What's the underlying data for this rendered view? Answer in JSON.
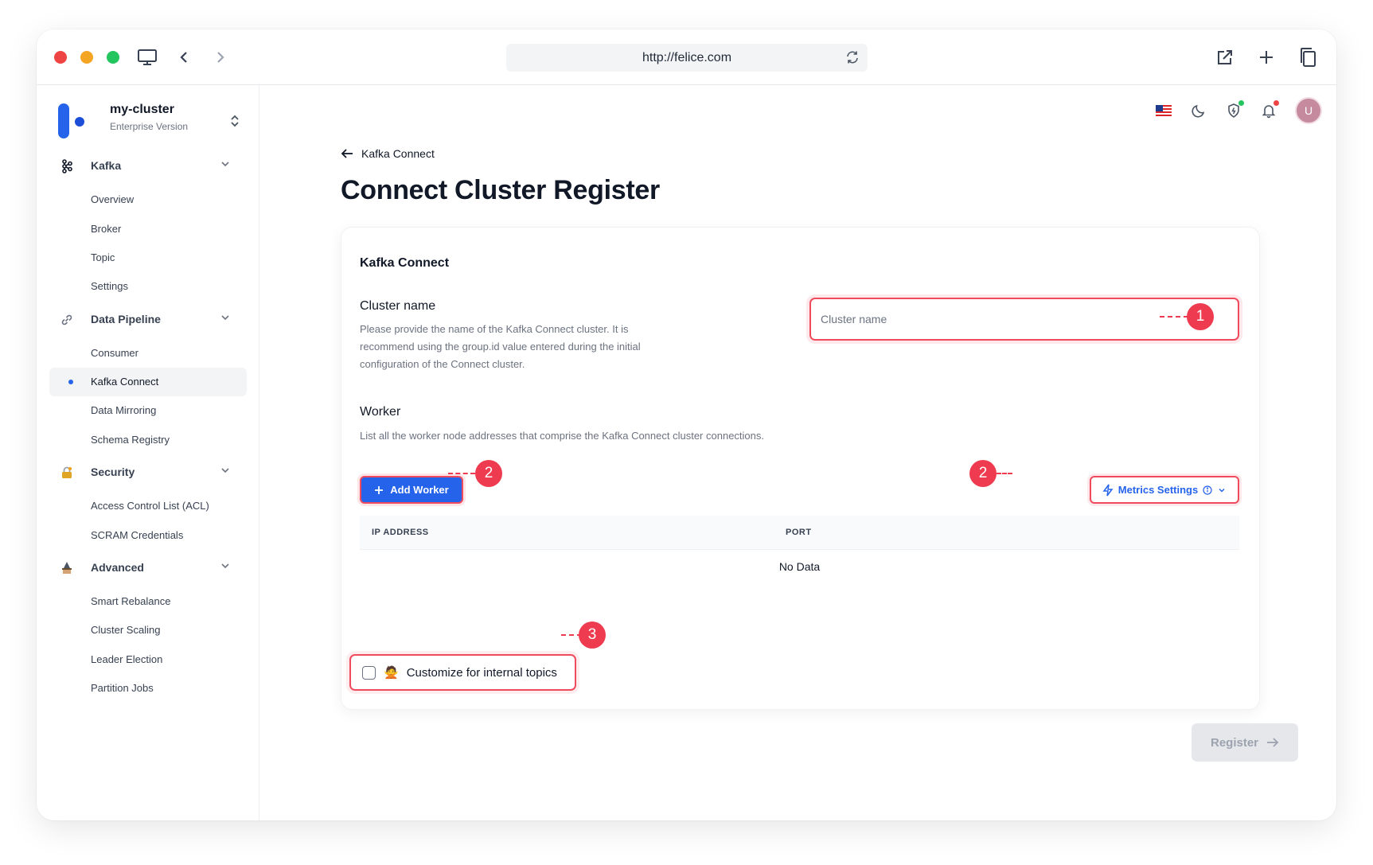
{
  "browser": {
    "url": "http://felice.com",
    "traffic_lights": [
      "#ef4444",
      "#f5a524",
      "#22c55e"
    ]
  },
  "sidebar": {
    "cluster_name": "my-cluster",
    "cluster_edition": "Enterprise Version",
    "groups": [
      {
        "label": "Kafka",
        "icon": "kafka-icon",
        "items": [
          "Overview",
          "Broker",
          "Topic",
          "Settings"
        ]
      },
      {
        "label": "Data Pipeline",
        "icon": "link-icon",
        "items": [
          "Consumer",
          "Kafka Connect",
          "Data Mirroring",
          "Schema Registry"
        ]
      },
      {
        "label": "Security",
        "icon": "lock-icon",
        "items": [
          "Access Control List (ACL)",
          "SCRAM Credentials"
        ]
      },
      {
        "label": "Advanced",
        "icon": "wizard-icon",
        "items": [
          "Smart Rebalance",
          "Cluster Scaling",
          "Leader Election",
          "Partition Jobs"
        ]
      }
    ],
    "active_item": "Kafka Connect"
  },
  "header": {
    "avatar_initial": "U",
    "icons": [
      "us-flag-icon",
      "moon-icon",
      "shield-icon",
      "bell-icon"
    ]
  },
  "page": {
    "back_label": "Kafka Connect",
    "title": "Connect Cluster Register"
  },
  "form": {
    "card_title": "Kafka Connect",
    "cluster_name": {
      "label": "Cluster name",
      "description": "Please provide the name of the Kafka Connect cluster. It is recommend using the group.id value entered during the initial configuration of the Connect cluster.",
      "placeholder": "Cluster name",
      "value": ""
    },
    "worker": {
      "label": "Worker",
      "description": "List all the worker node addresses that comprise the Kafka Connect cluster connections.",
      "add_button": "Add Worker",
      "metrics_button": "Metrics Settings",
      "columns": [
        "IP ADDRESS",
        "PORT"
      ],
      "rows": [],
      "empty_text": "No Data"
    },
    "customize_label": "Customize for internal topics",
    "customize_emoji": "🙅",
    "customize_checked": false,
    "register_button": "Register"
  },
  "callouts": [
    "1",
    "2",
    "2",
    "3"
  ],
  "colors": {
    "accent": "#2563eb",
    "callout": "#ef3b4f",
    "register_disabled_bg": "#e5e7eb"
  }
}
